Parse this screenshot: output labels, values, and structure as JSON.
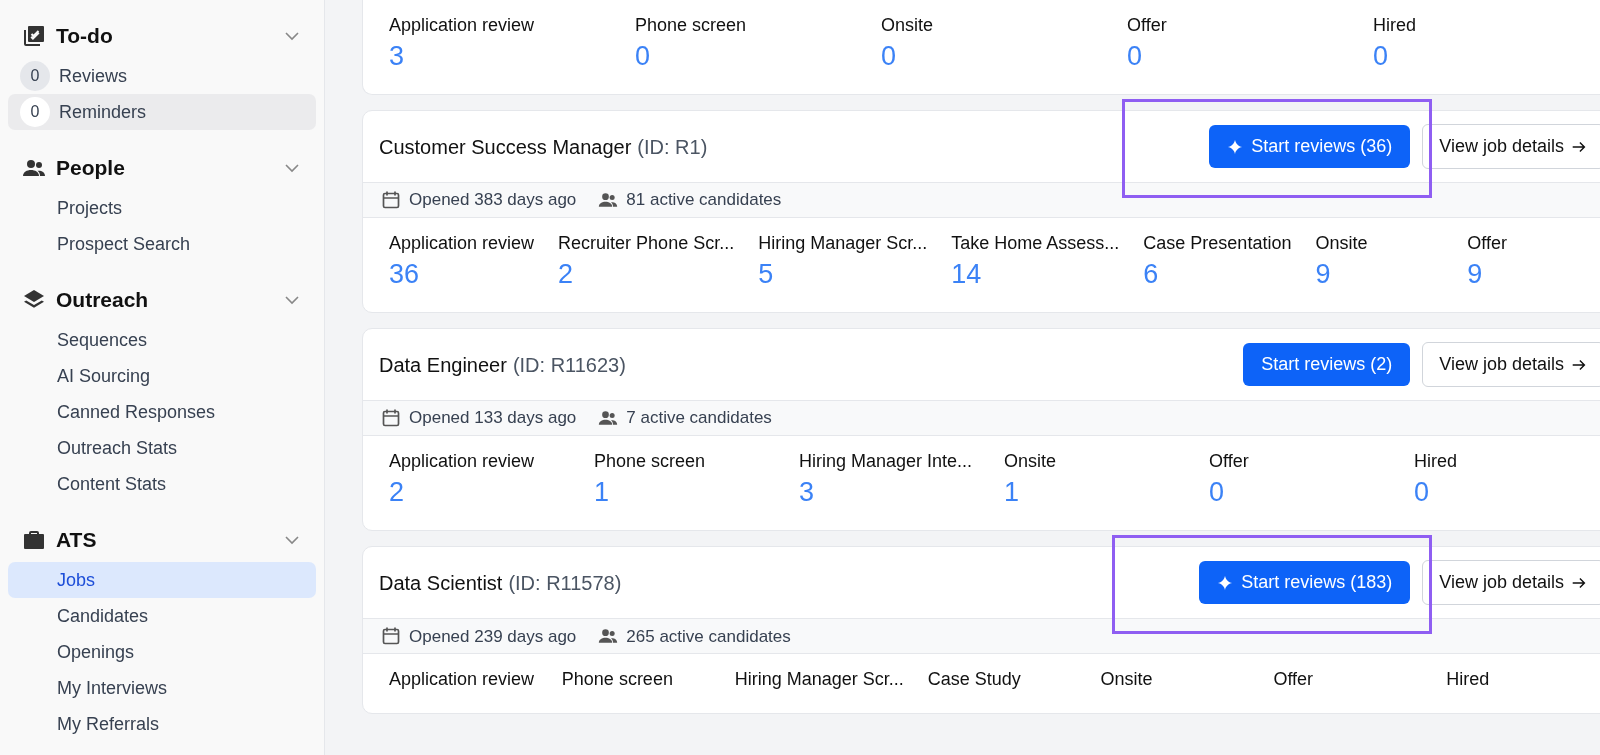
{
  "sidebar": {
    "sections": [
      {
        "title": "To-do",
        "expanded": true,
        "items": [
          {
            "label": "Reviews",
            "count": "0",
            "selected": false
          },
          {
            "label": "Reminders",
            "count": "0",
            "selected": true
          }
        ]
      },
      {
        "title": "People",
        "expanded": true,
        "items": [
          {
            "label": "Projects",
            "selected": false
          },
          {
            "label": "Prospect Search",
            "selected": false
          }
        ]
      },
      {
        "title": "Outreach",
        "expanded": true,
        "items": [
          {
            "label": "Sequences",
            "selected": false
          },
          {
            "label": "AI Sourcing",
            "selected": false
          },
          {
            "label": "Canned Responses",
            "selected": false
          },
          {
            "label": "Outreach Stats",
            "selected": false
          },
          {
            "label": "Content Stats",
            "selected": false
          }
        ]
      },
      {
        "title": "ATS",
        "expanded": true,
        "items": [
          {
            "label": "Jobs",
            "selected": true
          },
          {
            "label": "Candidates",
            "selected": false
          },
          {
            "label": "Openings",
            "selected": false
          },
          {
            "label": "My Interviews",
            "selected": false
          },
          {
            "label": "My Referrals",
            "selected": false
          }
        ]
      }
    ]
  },
  "jobs": [
    {
      "stages": [
        {
          "label": "Application review",
          "count": "3"
        },
        {
          "label": "Phone screen",
          "count": "0"
        },
        {
          "label": "Onsite",
          "count": "0"
        },
        {
          "label": "Offer",
          "count": "0"
        },
        {
          "label": "Hired",
          "count": "0"
        }
      ]
    },
    {
      "title": "Customer Success Manager",
      "id_label": "(ID: R1)",
      "start_button": "Start reviews (36)",
      "sparkle": true,
      "highlighted": true,
      "details_button": "View job details",
      "opened": "Opened 383 days ago",
      "candidates": "81 active candidates",
      "stages": [
        {
          "label": "Application review",
          "count": "36"
        },
        {
          "label": "Recruiter Phone Scr...",
          "count": "2"
        },
        {
          "label": "Hiring Manager Scr...",
          "count": "5"
        },
        {
          "label": "Take Home Assess...",
          "count": "14"
        },
        {
          "label": "Case Presentation",
          "count": "6"
        },
        {
          "label": "Onsite",
          "count": "9"
        },
        {
          "label": "Offer",
          "count": "9"
        }
      ]
    },
    {
      "title": "Data Engineer",
      "id_label": "(ID: R11623)",
      "start_button": "Start reviews (2)",
      "sparkle": false,
      "highlighted": false,
      "details_button": "View job details",
      "opened": "Opened 133 days ago",
      "candidates": "7 active candidates",
      "stages": [
        {
          "label": "Application review",
          "count": "2"
        },
        {
          "label": "Phone screen",
          "count": "1"
        },
        {
          "label": "Hiring Manager Inte...",
          "count": "3"
        },
        {
          "label": "Onsite",
          "count": "1"
        },
        {
          "label": "Offer",
          "count": "0"
        },
        {
          "label": "Hired",
          "count": "0"
        }
      ]
    },
    {
      "title": "Data Scientist",
      "id_label": "(ID: R11578)",
      "start_button": "Start reviews (183)",
      "sparkle": true,
      "highlighted": true,
      "details_button": "View job details",
      "opened": "Opened 239 days ago",
      "candidates": "265 active candidates",
      "stages": [
        {
          "label": "Application review"
        },
        {
          "label": "Phone screen"
        },
        {
          "label": "Hiring Manager Scr..."
        },
        {
          "label": "Case Study"
        },
        {
          "label": "Onsite"
        },
        {
          "label": "Offer"
        },
        {
          "label": "Hired"
        }
      ]
    }
  ]
}
